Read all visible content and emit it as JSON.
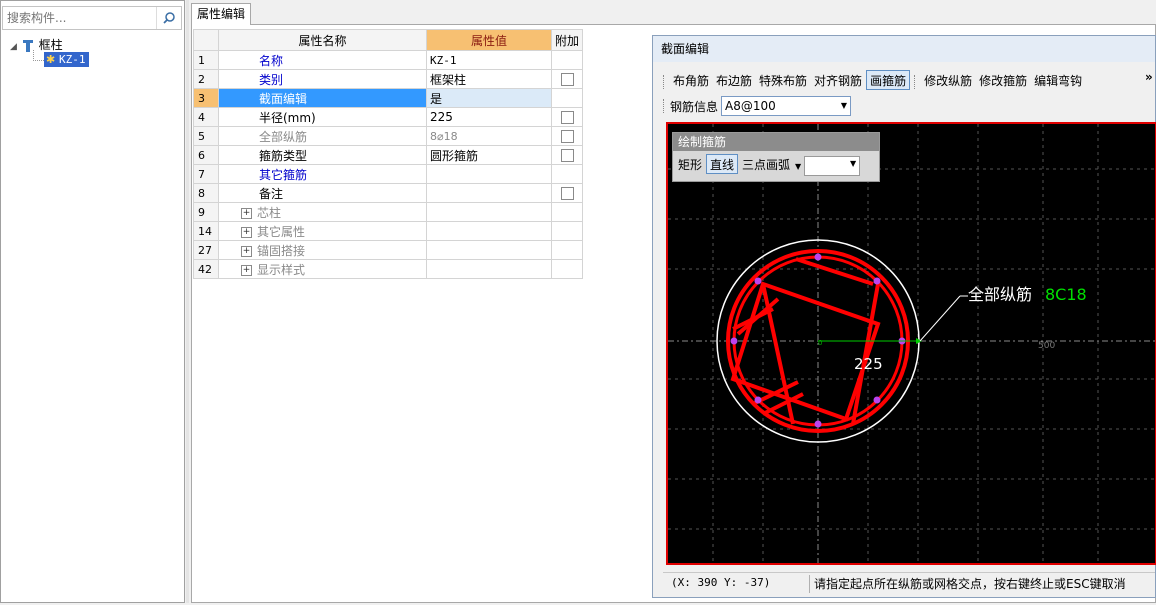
{
  "search": {
    "placeholder": "搜索构件..."
  },
  "tree": {
    "root": "框柱",
    "child": "KZ-1"
  },
  "tab": {
    "label": "属性编辑"
  },
  "grid": {
    "headers": {
      "name": "属性名称",
      "value": "属性值",
      "extra": "附加"
    },
    "rows": [
      {
        "num": "1",
        "name": "名称",
        "value": "KZ-1"
      },
      {
        "num": "2",
        "name": "类别",
        "value": "框架柱"
      },
      {
        "num": "3",
        "name": "截面编辑",
        "value": "是"
      },
      {
        "num": "4",
        "name": "半径(mm)",
        "value": "225"
      },
      {
        "num": "5",
        "name": "全部纵筋",
        "value": "8⌀18"
      },
      {
        "num": "6",
        "name": "箍筋类型",
        "value": "圆形箍筋"
      },
      {
        "num": "7",
        "name": "其它箍筋",
        "value": ""
      },
      {
        "num": "8",
        "name": "备注",
        "value": ""
      },
      {
        "num": "9",
        "name": "芯柱",
        "value": ""
      },
      {
        "num": "14",
        "name": "其它属性",
        "value": ""
      },
      {
        "num": "27",
        "name": "锚固搭接",
        "value": ""
      },
      {
        "num": "42",
        "name": "显示样式",
        "value": ""
      }
    ]
  },
  "section_editor": {
    "title": "截面编辑",
    "toolbar": [
      "布角筋",
      "布边筋",
      "特殊布筋",
      "对齐钢筋",
      "画箍筋",
      "修改纵筋",
      "修改箍筋",
      "编辑弯钩"
    ],
    "more": "»",
    "rebar_info_label": "钢筋信息",
    "rebar_info_value": "A8@100",
    "draw_panel": {
      "title": "绘制箍筋",
      "tools": [
        "矩形",
        "直线",
        "三点画弧"
      ]
    },
    "canvas": {
      "annotation_label": "全部纵筋",
      "annotation_value": "8C18",
      "radius_label": "225",
      "axis_label": "500",
      "origin_mark": "0"
    },
    "status": {
      "coords": "(X: 390 Y: -37)",
      "hint": "请指定起点所在纵筋或网格交点，按右键终止或ESC键取消"
    }
  },
  "colors": {
    "accent_orange": "#f7c072",
    "selection_blue": "#3399ff",
    "rebar_red": "#ff0000",
    "annotation_green": "#00e000"
  }
}
